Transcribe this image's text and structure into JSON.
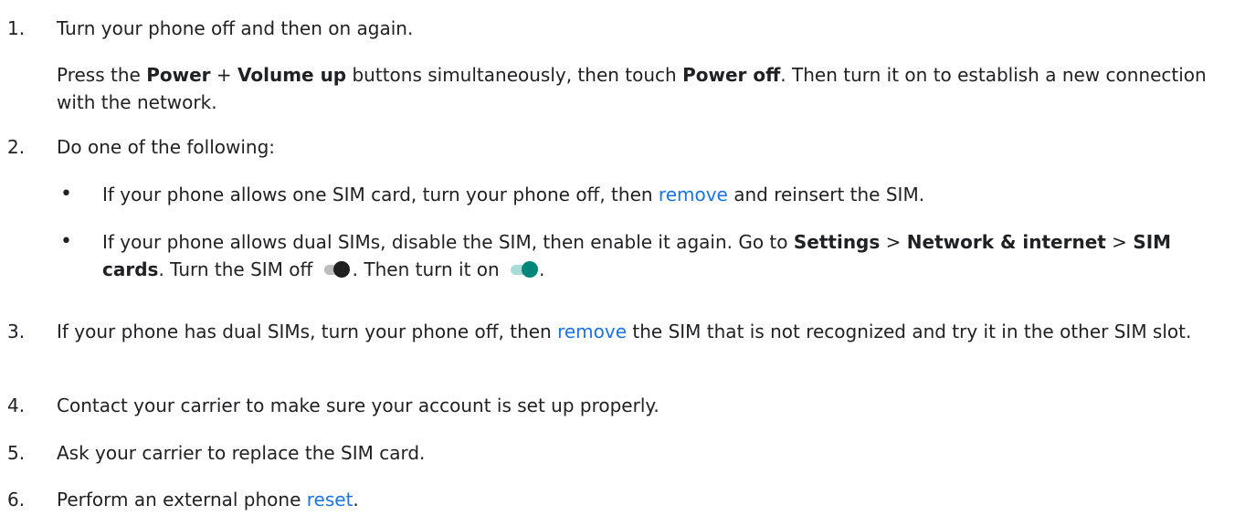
{
  "steps": [
    {
      "number": "1.",
      "text": "Turn your phone off and then on again.",
      "detail": {
        "t1": "Press the ",
        "b1": "Power",
        "t2": " + ",
        "b2": "Volume up",
        "t3": " buttons simultaneously, then touch ",
        "b3": "Power off",
        "t4": ". Then turn it on to establish a new connection with the network."
      }
    },
    {
      "number": "2.",
      "text": "Do one of the following:",
      "bullets": [
        {
          "marker": "•",
          "t1": "If your phone allows one SIM card, turn your phone off, then ",
          "link": "remove",
          "t2": " and reinsert the SIM."
        },
        {
          "marker": "•",
          "t1": "If your phone allows dual SIMs, disable the SIM, then enable it again. Go to ",
          "b1": "Settings",
          "t2": " > ",
          "b2": "Network & internet",
          "t3": " > ",
          "b3": "SIM cards",
          "t4": ". Turn the SIM off ",
          "t5": ". Then turn it on ",
          "t6": "."
        }
      ]
    },
    {
      "number": "3.",
      "t1": "If your phone has dual SIMs, turn your phone off, then ",
      "link": "remove",
      "t2": " the SIM that is not recognized and try it in the other SIM slot."
    },
    {
      "number": "4.",
      "text": "Contact your carrier to make sure your account is set up properly."
    },
    {
      "number": "5.",
      "text": "Ask your carrier to replace the SIM card."
    },
    {
      "number": "6.",
      "t1": "Perform an external phone ",
      "link": "reset",
      "t2": "."
    }
  ],
  "icons": {
    "toggle_off": "toggle-off-icon",
    "toggle_on": "toggle-on-icon"
  },
  "colors": {
    "text": "#202124",
    "link": "#1a73e8",
    "toggle_on": "#01877a"
  }
}
